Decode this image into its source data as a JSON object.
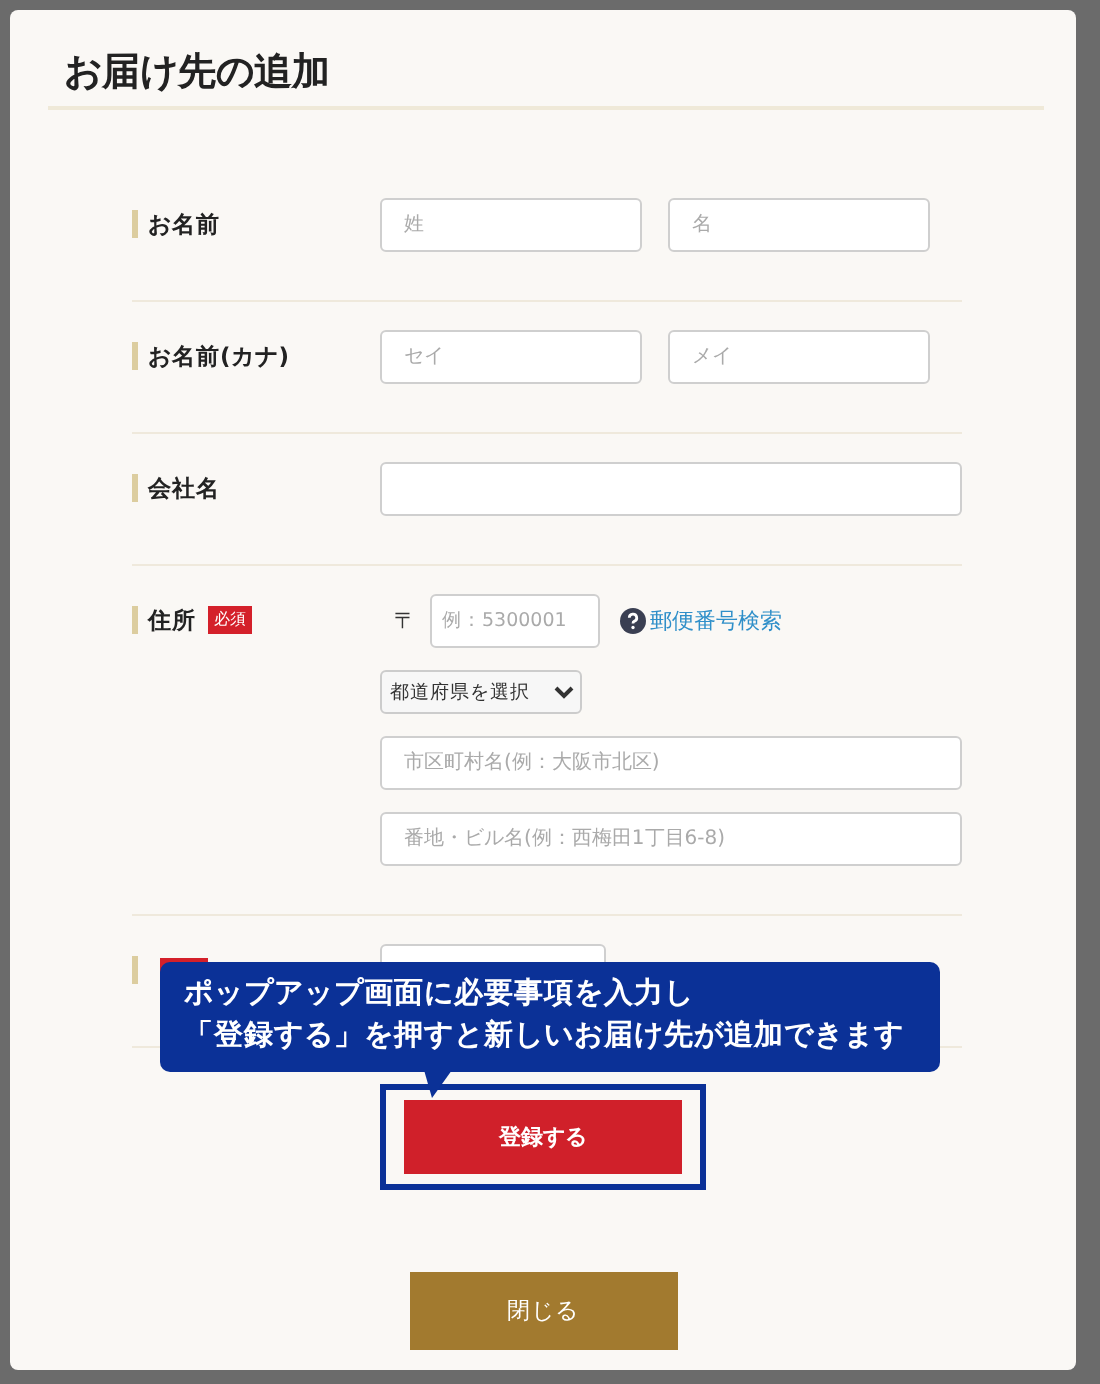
{
  "dialog": {
    "title": "お届け先の追加"
  },
  "rows": [
    {
      "kind": "pair",
      "label": "お名前",
      "required": false,
      "fields": [
        {
          "placeholder": "姓"
        },
        {
          "placeholder": "名"
        }
      ]
    },
    {
      "kind": "pair",
      "label": "お名前(カナ)",
      "required": false,
      "fields": [
        {
          "placeholder": "セイ"
        },
        {
          "placeholder": "メイ"
        }
      ]
    },
    {
      "kind": "single",
      "label": "会社名",
      "required": false
    },
    {
      "kind": "address",
      "label": "住所",
      "required": true,
      "badge": "必須",
      "postal_mark": "〒",
      "postal_placeholder": "例：5300001",
      "help_link": "郵便番号検索",
      "prefecture": "都道府県を選択",
      "lines": [
        {
          "placeholder": "市区町村名(例：大阪市北区)"
        },
        {
          "placeholder": "番地・ビル名(例：西梅田1丁目6-8)"
        }
      ]
    },
    {
      "kind": "phone",
      "required": true
    }
  ],
  "callout": {
    "lines": [
      "ポップアップ画面に必要事項を入力し",
      "「登録する」を押すと新しいお届け先が追加できます"
    ]
  },
  "register_button": {
    "label": "登録する",
    "highlighted": true
  },
  "close_button": {
    "label": "閉じる"
  }
}
